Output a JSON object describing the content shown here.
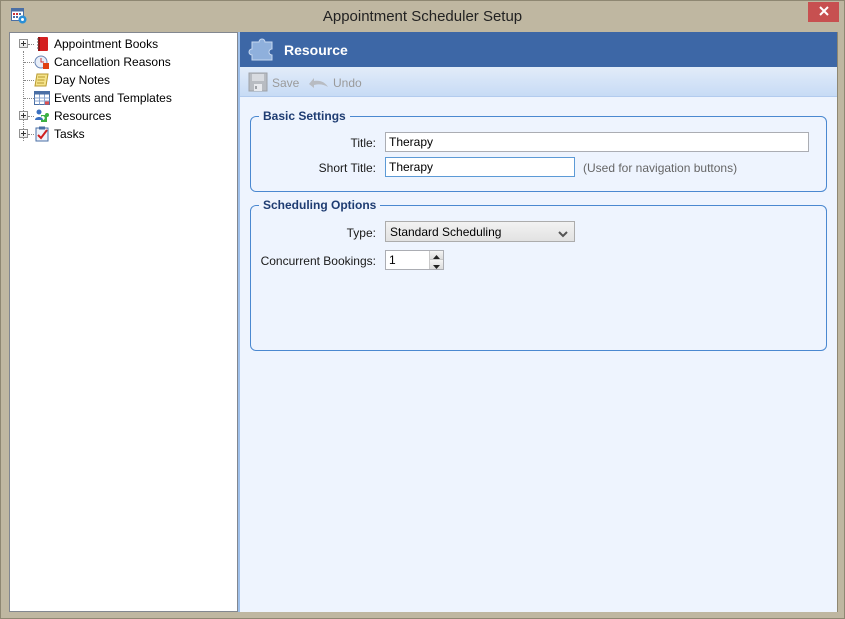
{
  "window": {
    "title": "Appointment Scheduler Setup",
    "close_icon": "close-x-icon"
  },
  "tree": {
    "items": [
      {
        "label": "Appointment Books",
        "icon": "red-book-icon",
        "expandable": true
      },
      {
        "label": "Cancellation Reasons",
        "icon": "clock-cancel-icon",
        "expandable": false
      },
      {
        "label": "Day Notes",
        "icon": "notepad-icon",
        "expandable": false
      },
      {
        "label": "Events and Templates",
        "icon": "calendar-grid-icon",
        "expandable": false
      },
      {
        "label": "Resources",
        "icon": "puzzle-people-icon",
        "expandable": true
      },
      {
        "label": "Tasks",
        "icon": "clipboard-check-icon",
        "expandable": true
      }
    ]
  },
  "header": {
    "title": "Resource",
    "icon": "puzzle-piece-icon"
  },
  "toolbar": {
    "save_label": "Save",
    "undo_label": "Undo"
  },
  "basic_settings": {
    "group_title": "Basic Settings",
    "title_label": "Title:",
    "title_value": "Therapy",
    "short_title_label": "Short Title:",
    "short_title_value": "Therapy",
    "short_title_hint": "(Used for navigation buttons)"
  },
  "scheduling_options": {
    "group_title": "Scheduling Options",
    "type_label": "Type:",
    "type_value": "Standard Scheduling",
    "concurrent_label": "Concurrent Bookings:",
    "concurrent_value": "1"
  },
  "colors": {
    "header_bg": "#3d67a6",
    "group_border": "#4a88d0",
    "close_button": "#c75050",
    "panel_bg": "#eef4fe"
  }
}
